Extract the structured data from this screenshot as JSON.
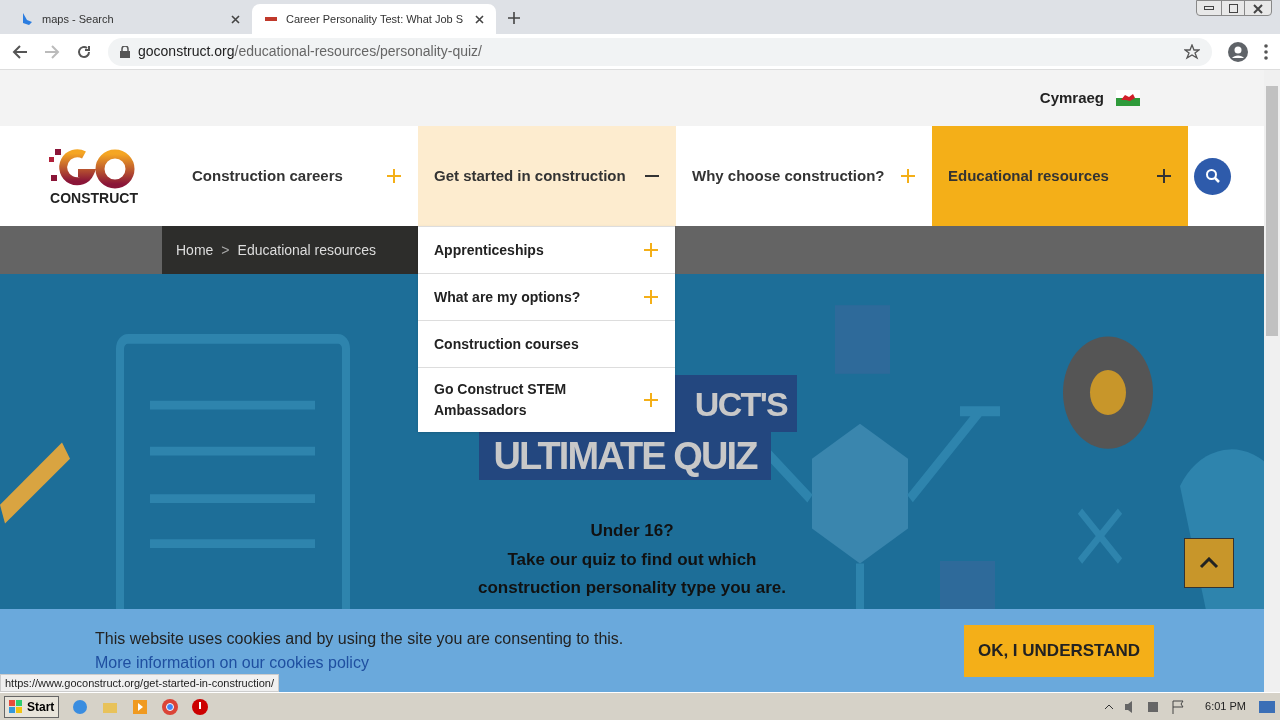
{
  "browser": {
    "tabs": [
      {
        "title": "maps - Search",
        "selected": false
      },
      {
        "title": "Career Personality Test: What Job S",
        "selected": true
      }
    ],
    "address": {
      "domain": "goconstruct.org",
      "path": "/educational-resources/personality-quiz/"
    }
  },
  "site": {
    "language_link": "Cymraeg",
    "logo_word": "CONSTRUCT",
    "nav": [
      {
        "label": "Construction careers",
        "expanded": false,
        "active": false
      },
      {
        "label": "Get started in construction",
        "expanded": true,
        "active": false
      },
      {
        "label": "Why choose construction?",
        "expanded": false,
        "active": false
      },
      {
        "label": "Educational resources",
        "expanded": false,
        "active": true
      }
    ],
    "breadcrumb": [
      "Home",
      "Educational resources"
    ],
    "breadcrumb_separator": ">",
    "dropdown": [
      {
        "label": "Apprenticeships",
        "has_children": true
      },
      {
        "label": "What are my options?",
        "has_children": true
      },
      {
        "label": "Construction courses",
        "has_children": false
      },
      {
        "label": "Go Construct STEM Ambassadors",
        "has_children": true
      }
    ],
    "hero": {
      "title_lines": [
        "UCT'S",
        "ULTIMATE QUIZ"
      ],
      "heading": "Under 16?",
      "text": "Take our quiz to find out which construction personality type you are."
    },
    "cookie": {
      "text": "This website uses cookies and by using the site you are consenting to this.",
      "link": "More information on our cookies policy",
      "button": "OK, I UNDERSTAND"
    }
  },
  "status_url": "https://www.goconstruct.org/get-started-in-construction/",
  "taskbar": {
    "start": "Start",
    "clock": "6:01 PM"
  }
}
